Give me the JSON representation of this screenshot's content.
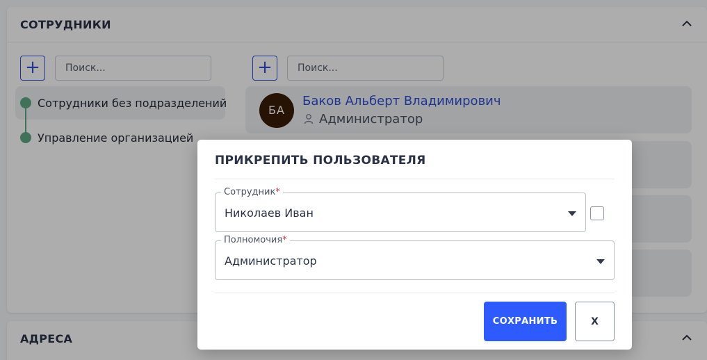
{
  "employees_section": {
    "title": "СОТРУДНИКИ",
    "departments_panel": {
      "add_symbol": "+",
      "search_placeholder": "Поиск...",
      "items": [
        {
          "label": "Сотрудники без подразделений"
        },
        {
          "label": "Управление организацией"
        }
      ]
    },
    "users_panel": {
      "add_symbol": "+",
      "search_placeholder": "Поиск...",
      "users": [
        {
          "initials": "БА",
          "name": "Баков Альберт Владимирович",
          "role": "Администратор"
        }
      ]
    }
  },
  "addresses_section": {
    "title": "АДРЕСА"
  },
  "dialog": {
    "title": "ПРИКРЕПИТЬ ПОЛЬЗОВАТЕЛЯ",
    "employee_field": {
      "label": "Сотрудник",
      "required_mark": "*",
      "value": "Николаев Иван"
    },
    "permissions_field": {
      "label": "Полномочия",
      "required_mark": "*",
      "value": "Администратор"
    },
    "save_label": "СОХРАНИТЬ",
    "close_label": "X"
  },
  "colors": {
    "accent": "#2e5bff",
    "link": "#2f4fd8",
    "tree": "#5ea983",
    "avatar_bg": "#3a1d05",
    "required": "#d1344b"
  }
}
